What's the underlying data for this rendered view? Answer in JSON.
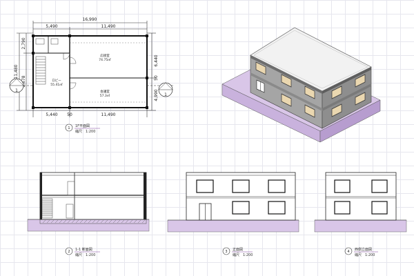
{
  "plan": {
    "dims": {
      "top_total": "16,990",
      "top_left": "5,490",
      "top_right": "11,490",
      "bottom_left": "5,440",
      "bottom_mid": "50",
      "bottom_right": "11,490",
      "left_total": "11,480",
      "left_upper": "2,790",
      "left_lower": "8,678",
      "right_upper": "6,440",
      "right_mid": "50",
      "right_lower": "4,990"
    },
    "rooms": [
      {
        "name": "応接室",
        "area": "74.75㎡"
      },
      {
        "name": "ロビー",
        "area": "55.41㎡"
      },
      {
        "name": "会議室",
        "area": "57.3㎡"
      }
    ],
    "markers": {
      "left": "1",
      "right": "1"
    }
  },
  "captions": [
    {
      "num": "1",
      "title": "1F平面図",
      "scale": "縮尺　1:200"
    },
    {
      "num": "2",
      "title": "1-1 断面図",
      "scale": "縮尺　1:200"
    },
    {
      "num": "3",
      "title": "正面図",
      "scale": "縮尺　1:200"
    },
    {
      "num": "4",
      "title": "西側立面図",
      "scale": "縮尺　1:200"
    }
  ],
  "colors": {
    "ground": "#d9c6e8",
    "window_glass": "#ead7b0",
    "roof": "#f2f2f2",
    "wall": "#9a9a9a",
    "caption_title": "#7b3f9a"
  }
}
